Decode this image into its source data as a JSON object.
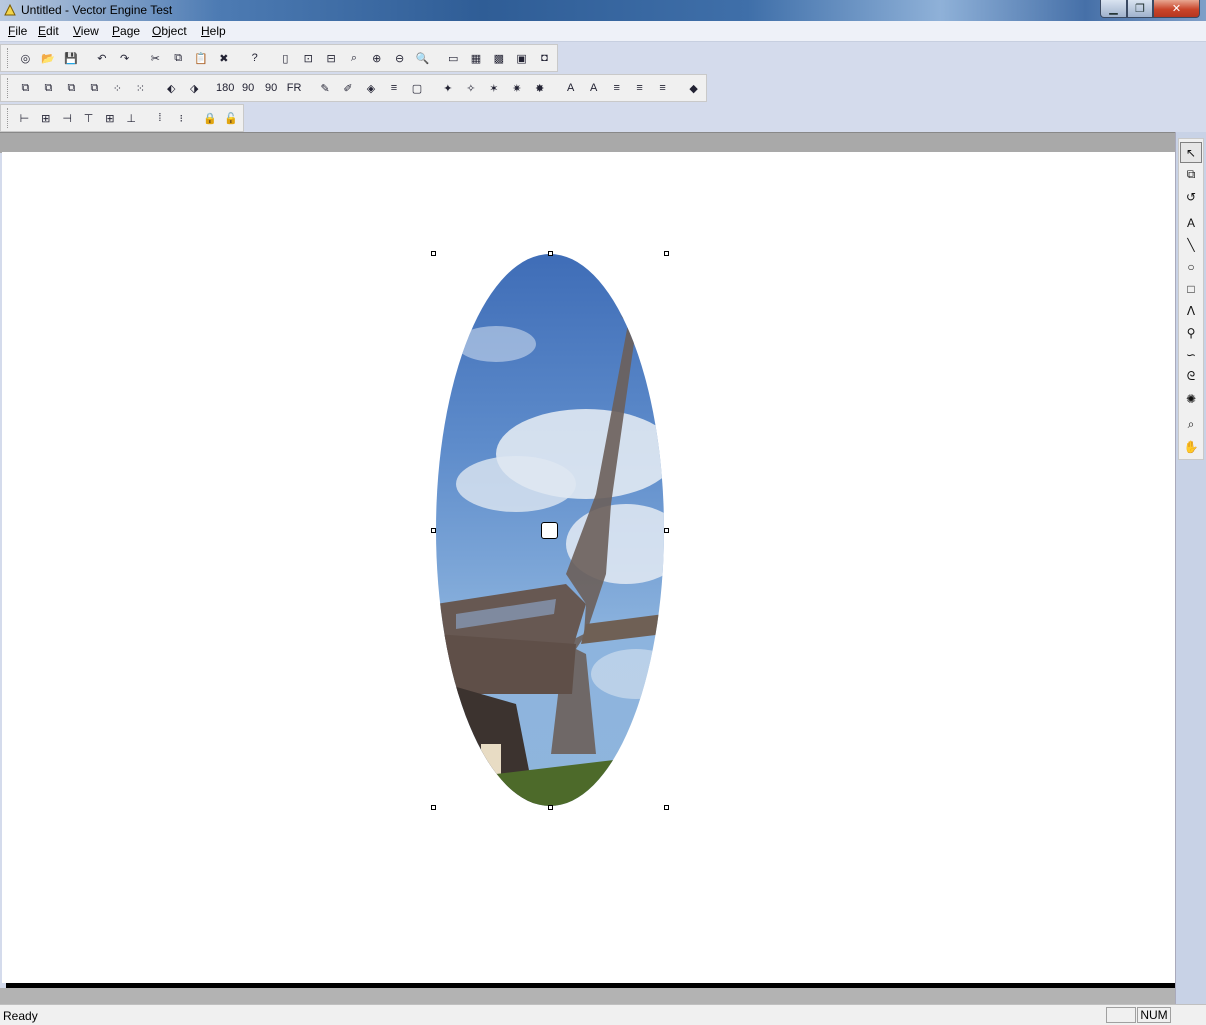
{
  "window": {
    "title": "Untitled - Vector Engine Test",
    "close_symbol": "✕",
    "min_symbol": "▁",
    "max_symbol": "❐"
  },
  "menu": [
    "File",
    "Edit",
    "View",
    "Page",
    "Object",
    "Help"
  ],
  "toolbar1": {
    "buttons": [
      {
        "icon": "new-icon",
        "glyph": "◎"
      },
      {
        "icon": "open-icon",
        "glyph": "📂"
      },
      {
        "icon": "save-icon",
        "glyph": "💾"
      },
      {
        "icon": "undo-icon",
        "glyph": "↶"
      },
      {
        "icon": "redo-icon",
        "glyph": "↷"
      },
      {
        "icon": "cut-icon",
        "glyph": "✂"
      },
      {
        "icon": "copy-icon",
        "glyph": "⧉"
      },
      {
        "icon": "paste-icon",
        "glyph": "📋"
      },
      {
        "icon": "delete-icon",
        "glyph": "✖"
      },
      {
        "icon": "help-icon",
        "glyph": "?"
      },
      {
        "icon": "page-icon",
        "glyph": "▯"
      },
      {
        "icon": "zoom-page-icon",
        "glyph": "⊡"
      },
      {
        "icon": "zoom-width-icon",
        "glyph": "⊟"
      },
      {
        "icon": "zoom-fit-icon",
        "glyph": "⌕"
      },
      {
        "icon": "zoom-in-icon",
        "glyph": "⊕"
      },
      {
        "icon": "zoom-out-icon",
        "glyph": "⊖"
      },
      {
        "icon": "zoom-select-icon",
        "glyph": "🔍"
      },
      {
        "icon": "view-normal-icon",
        "glyph": "▭"
      },
      {
        "icon": "grid-icon",
        "glyph": "▦"
      },
      {
        "icon": "grid-snap-icon",
        "glyph": "▩"
      },
      {
        "icon": "view-frame-icon",
        "glyph": "▣"
      },
      {
        "icon": "view-center-icon",
        "glyph": "◘"
      }
    ]
  },
  "toolbar2": {
    "buttons": [
      {
        "icon": "bring-front-icon",
        "glyph": "⧉"
      },
      {
        "icon": "send-back-icon",
        "glyph": "⧉"
      },
      {
        "icon": "bring-forward-icon",
        "glyph": "⧉"
      },
      {
        "icon": "send-backward-icon",
        "glyph": "⧉"
      },
      {
        "icon": "group-icon",
        "glyph": "⁘"
      },
      {
        "icon": "ungroup-icon",
        "glyph": "⁙"
      },
      {
        "icon": "flip-h-icon",
        "glyph": "⬖"
      },
      {
        "icon": "flip-v-icon",
        "glyph": "⬗"
      },
      {
        "icon": "rotate-180-icon",
        "glyph": "180"
      },
      {
        "icon": "rotate-90-cw-icon",
        "glyph": "90"
      },
      {
        "icon": "rotate-90-ccw-icon",
        "glyph": "90"
      },
      {
        "icon": "rotate-free-icon",
        "glyph": "FR"
      },
      {
        "icon": "pen-icon",
        "glyph": "✎"
      },
      {
        "icon": "brush-icon",
        "glyph": "✐"
      },
      {
        "icon": "fill-icon",
        "glyph": "◈"
      },
      {
        "icon": "lines-icon",
        "glyph": "≡"
      },
      {
        "icon": "rect-shadow-icon",
        "glyph": "▢"
      },
      {
        "icon": "node-edit-icon",
        "glyph": "✦"
      },
      {
        "icon": "node-add-icon",
        "glyph": "✧"
      },
      {
        "icon": "node-delete-icon",
        "glyph": "✶"
      },
      {
        "icon": "node-break-icon",
        "glyph": "✷"
      },
      {
        "icon": "node-join-icon",
        "glyph": "✸"
      },
      {
        "icon": "text-bold-icon",
        "glyph": "A"
      },
      {
        "icon": "text-frame-icon",
        "glyph": "A"
      },
      {
        "icon": "align-left-icon",
        "glyph": "≡"
      },
      {
        "icon": "align-center-icon",
        "glyph": "≡"
      },
      {
        "icon": "align-right-icon",
        "glyph": "≡"
      },
      {
        "icon": "color-icon",
        "glyph": "◆"
      }
    ]
  },
  "toolbar3": {
    "buttons": [
      {
        "icon": "align-left-edge-icon",
        "glyph": "⊢"
      },
      {
        "icon": "align-hcenter-icon",
        "glyph": "⊞"
      },
      {
        "icon": "align-right-edge-icon",
        "glyph": "⊣"
      },
      {
        "icon": "align-top-icon",
        "glyph": "⊤"
      },
      {
        "icon": "align-vcenter-icon",
        "glyph": "⊞"
      },
      {
        "icon": "align-bottom-icon",
        "glyph": "⊥"
      },
      {
        "icon": "distribute-h-icon",
        "glyph": "⁞"
      },
      {
        "icon": "distribute-v-icon",
        "glyph": "⁝"
      },
      {
        "icon": "lock-icon",
        "glyph": "🔒"
      },
      {
        "icon": "unlock-icon",
        "glyph": "🔓"
      }
    ]
  },
  "tools": [
    {
      "icon": "select-arrow-icon",
      "glyph": "↖",
      "pressed": true
    },
    {
      "icon": "transform-icon",
      "glyph": "⧉"
    },
    {
      "icon": "rotate-tool-icon",
      "glyph": "↺"
    },
    {
      "icon": "text-tool-icon",
      "glyph": "A"
    },
    {
      "icon": "line-tool-icon",
      "glyph": "╲"
    },
    {
      "icon": "ellipse-tool-icon",
      "glyph": "○"
    },
    {
      "icon": "rectangle-tool-icon",
      "glyph": "□"
    },
    {
      "icon": "polyline-tool-icon",
      "glyph": "ⴷ"
    },
    {
      "icon": "bezier-tool-icon",
      "glyph": "⚲"
    },
    {
      "icon": "freehand-tool-icon",
      "glyph": "∽"
    },
    {
      "icon": "spiral-tool-icon",
      "glyph": "ᘓ"
    },
    {
      "icon": "star-tool-icon",
      "glyph": "✺"
    },
    {
      "icon": "zoom-tool-icon",
      "glyph": "⌕"
    },
    {
      "icon": "hand-tool-icon",
      "glyph": "✋"
    }
  ],
  "status": {
    "text": "Ready",
    "num": "NUM"
  }
}
